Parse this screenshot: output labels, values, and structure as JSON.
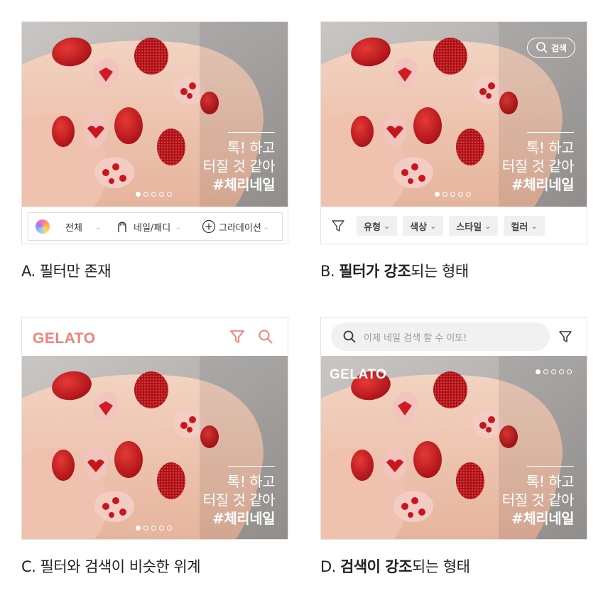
{
  "photo_text": {
    "line1": "톡! 하고",
    "line2": "터질 것 같아",
    "line3": "#체리네일"
  },
  "panelA": {
    "filters": [
      {
        "label": "전체",
        "icon": "rainbow-color-icon"
      },
      {
        "label": "네일/패디",
        "icon": "nail-icon"
      },
      {
        "label": "그라데이션",
        "icon": "plus-circle-icon"
      }
    ],
    "caption": "A. 필터만 존재"
  },
  "panelB": {
    "search_label": "검색",
    "chips": [
      "유형",
      "색상",
      "스타일",
      "컬러"
    ],
    "caption_prefix": "B. ",
    "caption_bold": "필터가 강조",
    "caption_rest": "되는 형태"
  },
  "panelC": {
    "logo": "GELATO",
    "caption": "C. 필터와 검색이 비슷한 위계"
  },
  "panelD": {
    "search_placeholder": "이제 네일 검색 할 수 이또!",
    "logo": "GELATO",
    "caption_prefix": "D. ",
    "caption_bold": "검색이 강조",
    "caption_rest": "되는 형태"
  },
  "colors": {
    "brand": "#f0807a",
    "nail_red": "#c8161d",
    "chip_bg": "#f0f0f0",
    "border": "#e3e3e3"
  }
}
